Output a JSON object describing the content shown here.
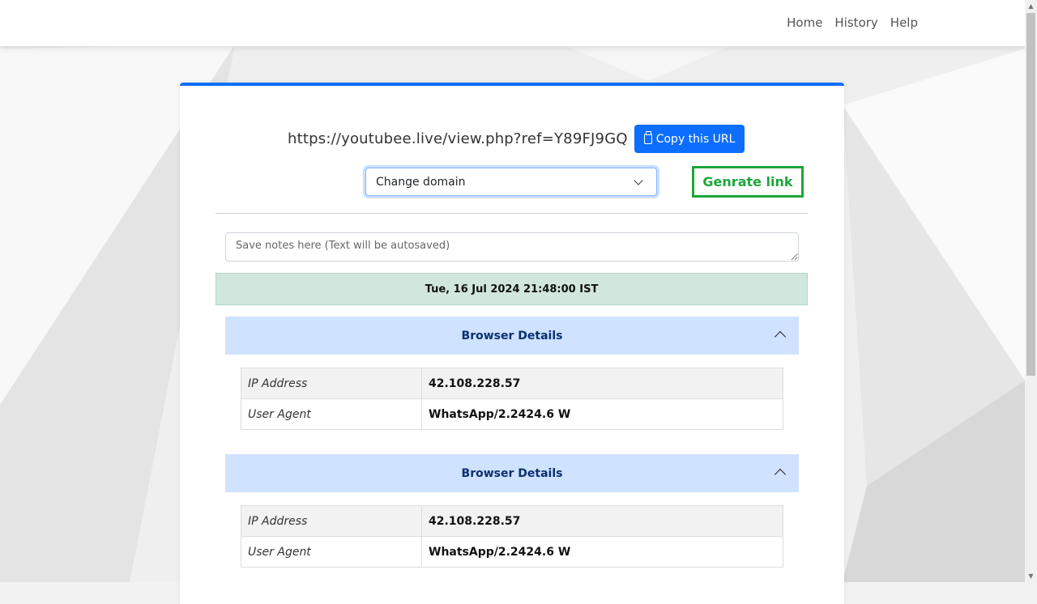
{
  "nav": {
    "home": "Home",
    "history": "History",
    "help": "Help"
  },
  "card": {
    "url": "https://youtubee.live/view.php?ref=Y89FJ9GQ",
    "copy_label": "Copy this URL",
    "domain_select": "Change domain",
    "generate_label": "Genrate link",
    "notes_placeholder": "Save notes here (Text will be autosaved)",
    "timestamp": "Tue, 16 Jul 2024 21:48:00 IST"
  },
  "sections": [
    {
      "title": "Browser Details",
      "rows": [
        {
          "key": "IP Address",
          "value": "42.108.228.57"
        },
        {
          "key": "User Agent",
          "value": "WhatsApp/2.2424.6 W"
        }
      ]
    },
    {
      "title": "Browser Details",
      "rows": [
        {
          "key": "IP Address",
          "value": "42.108.228.57"
        },
        {
          "key": "User Agent",
          "value": "WhatsApp/2.2424.6 W"
        }
      ]
    }
  ],
  "colors": {
    "primary": "#0d6efd",
    "generate_green": "#1ea63a",
    "accordion_bg": "#cfe2ff",
    "date_bg": "#d1e7dd"
  }
}
